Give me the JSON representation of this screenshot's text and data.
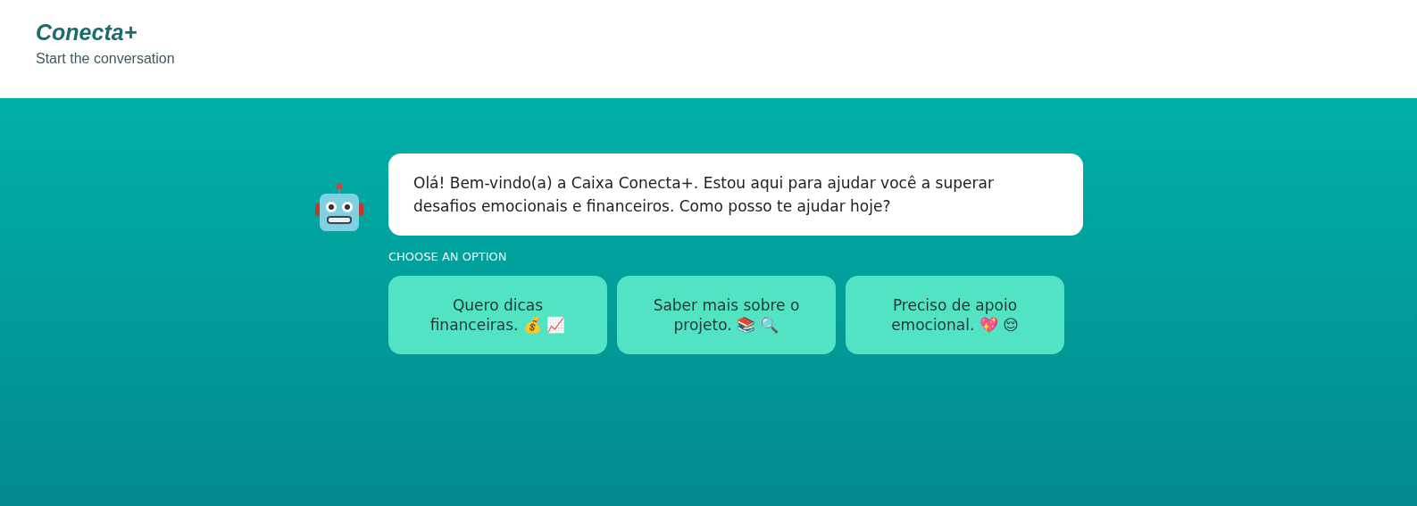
{
  "header": {
    "title": "Conecta+",
    "subtitle": "Start the conversation"
  },
  "message": {
    "text": "Olá! Bem-vindo(a) a Caixa Conecta+. Estou aqui para ajudar você a superar desafios emocionais e financeiros. Como posso te ajudar hoje?"
  },
  "options_label": "CHOOSE AN OPTION",
  "options": [
    "Quero dicas financeiras. 💰 📈",
    "Saber mais sobre o projeto. 📚 🔍",
    "Preciso de apoio emocional. 💖 😌"
  ]
}
